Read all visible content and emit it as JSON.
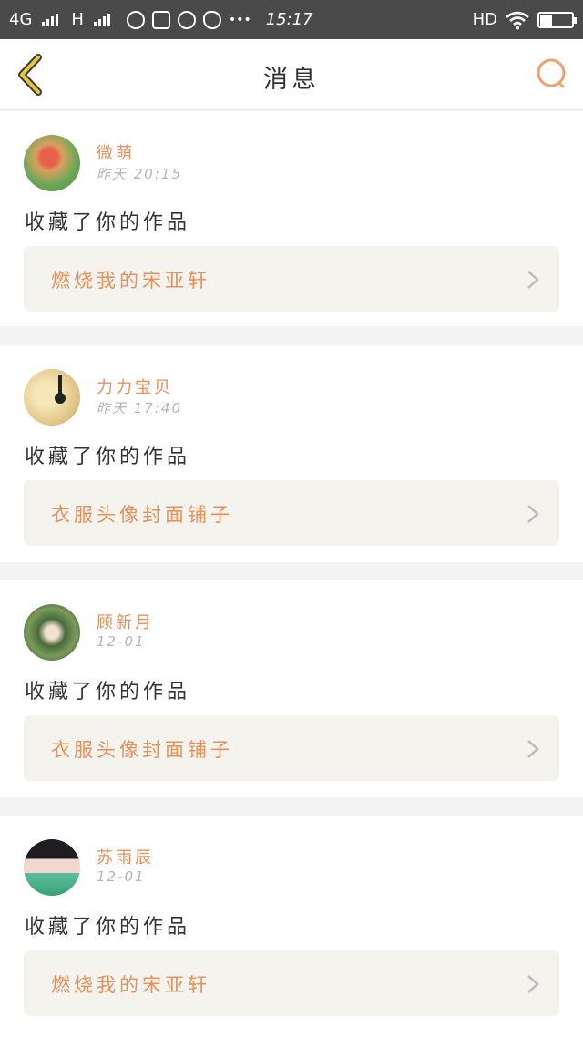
{
  "statusbar": {
    "network_left": "4G",
    "network_right": "H",
    "dots": "•••",
    "time": "15:17",
    "hd": "HD",
    "battery_level": 0.35
  },
  "topbar": {
    "title": "消息"
  },
  "messages": [
    {
      "name": "微萌",
      "time": "昨天 20:15",
      "action": "收藏了你的作品",
      "work": "燃烧我的宋亚轩"
    },
    {
      "name": "力力宝贝",
      "time": "昨天 17:40",
      "action": "收藏了你的作品",
      "work": "衣服头像封面铺子"
    },
    {
      "name": "顾新月",
      "time": "12-01",
      "action": "收藏了你的作品",
      "work": "衣服头像封面铺子"
    },
    {
      "name": "苏雨辰",
      "time": "12-01",
      "action": "收藏了你的作品",
      "work": "燃烧我的宋亚轩"
    }
  ],
  "colors": {
    "accent": "#e8905a",
    "back_arrow": "#e7c53a",
    "status_bar": "#4a4a4a"
  }
}
